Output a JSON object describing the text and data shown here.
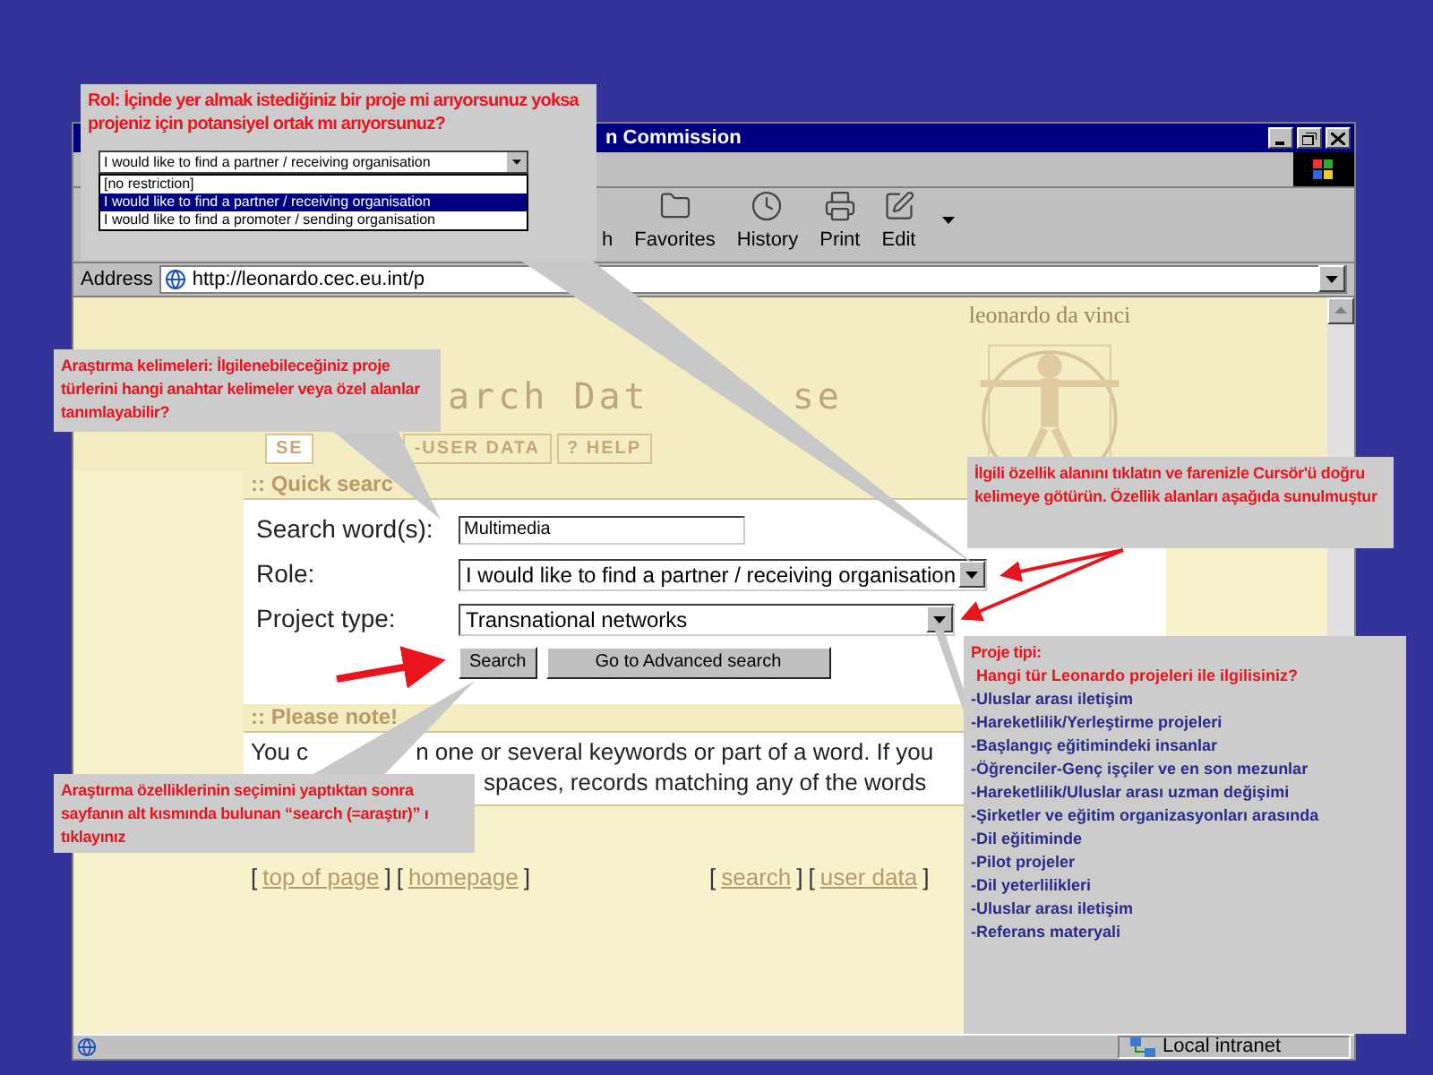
{
  "window": {
    "title": "n Commission"
  },
  "toolbar": [
    {
      "label": "h"
    },
    {
      "label": "Favorites"
    },
    {
      "label": "History"
    },
    {
      "label": "Print"
    },
    {
      "label": "Edit"
    }
  ],
  "address": {
    "label": "Address",
    "url": "http://leonardo.cec.eu.int/p"
  },
  "page": {
    "banner": "leonardo da vinci",
    "heading_parts": [
      "arch Dat",
      "se"
    ],
    "tabs": [
      {
        "label": "SE",
        "selected": true
      },
      {
        "label": "-USER DATA",
        "selected": false
      },
      {
        "label": "? HELP",
        "selected": false
      }
    ],
    "quick_search": {
      "title": ":: Quick searc",
      "fields": [
        {
          "kind": "input",
          "label": "Search word(s):",
          "value": "Multimedia"
        },
        {
          "kind": "select",
          "label": "Role:",
          "value": "I would like to find a partner / receiving organisation"
        },
        {
          "kind": "select",
          "label": "Project type:",
          "value": "Transnational networks"
        }
      ],
      "buttons": [
        "Search",
        "Go to Advanced search"
      ]
    },
    "note": {
      "title": ":: Please note!",
      "lines": [
        [
          "You c",
          "n one or several keywords or part of a word. If you"
        ],
        [
          "spaces, records matching any of the words"
        ]
      ]
    },
    "footer_left": [
      {
        "open": "[",
        "link": "top of page",
        "close": "]"
      },
      {
        "open": "[",
        "link": "homepage",
        "close": "]"
      }
    ],
    "footer_right": [
      {
        "open": "[",
        "link": "search",
        "close": "]"
      },
      {
        "open": "[",
        "link": "user data",
        "close": "]"
      }
    ]
  },
  "status_bar": {
    "zone": "Local intranet"
  },
  "callouts": [
    {
      "text": "Rol: İçinde yer almak istediğiniz bir proje mi arıyorsunuz yoksa projeniz için potansiyel ortak mı arıyorsunuz?",
      "dropdown": {
        "value": "I would like to find a partner / receiving organisation",
        "options": [
          {
            "label": "[no restriction]",
            "selected": false
          },
          {
            "label": "I would like to find a partner / receiving organisation",
            "selected": true
          },
          {
            "label": "I would like to find a promoter / sending organisation",
            "selected": false
          }
        ]
      }
    },
    {
      "text": "Araştırma kelimeleri: İlgilenebileceğiniz proje türlerini hangi anahtar kelimeler veya özel alanlar tanımlayabilir?"
    },
    {
      "text": "İlgili özellik alanını tıklatın ve farenizle Cursör'ü doğru kelimeye götürün. Özellik alanları aşağıda sunulmuştur"
    },
    {
      "text": "Araştırma özelliklerinin seçimini yaptıktan sonra sayfanın alt kısmında bulunan “search (=araştır)” ı tıklayınız"
    },
    {
      "text": "Proje tipi:",
      "question": "Hangi tür Leonardo projeleri ile ilgilisiniz?",
      "items": [
        "-Uluslar arası iletişim",
        "-Hareketlilik/Yerleştirme projeleri",
        "-Başlangıç eğitimindeki insanlar",
        "-Öğrenciler-Genç işçiler ve en son mezunlar",
        "-Hareketlilik/Uluslar arası uzman değişimi",
        "-Şirketler ve eğitim organizasyonları arasında",
        "-Dil eğitiminde",
        "-Pilot projeler",
        "-Dil yeterlilikleri",
        "-Uluslar arası iletişim",
        "-Referans materyali"
      ]
    }
  ]
}
